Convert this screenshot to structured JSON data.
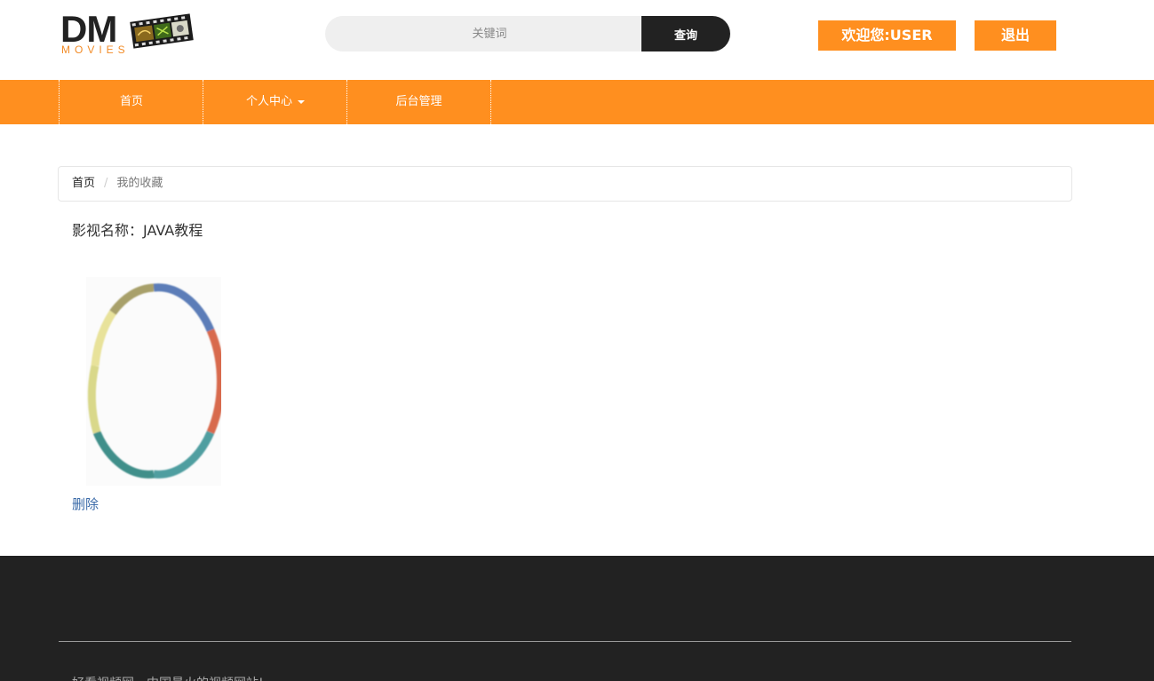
{
  "header": {
    "logo_main": "DM",
    "logo_sub": "MOVIES",
    "search_placeholder": "关键词",
    "search_button": "查询",
    "welcome_label": "欢迎您:USER",
    "logout_label": "退出"
  },
  "nav": {
    "items": [
      {
        "label": "首页"
      },
      {
        "label": "个人中心"
      },
      {
        "label": "后台管理"
      }
    ]
  },
  "breadcrumb": {
    "home": "首页",
    "separator": "/",
    "current": "我的收藏"
  },
  "favorite": {
    "movie_name": "影视名称：JAVA教程",
    "delete_label": "删除"
  },
  "footer": {
    "text": "好看视频网，中国最火的视频网站!"
  },
  "colors": {
    "accent": "#ff8f1f",
    "dark": "#222222",
    "link": "#3a6aa8"
  }
}
